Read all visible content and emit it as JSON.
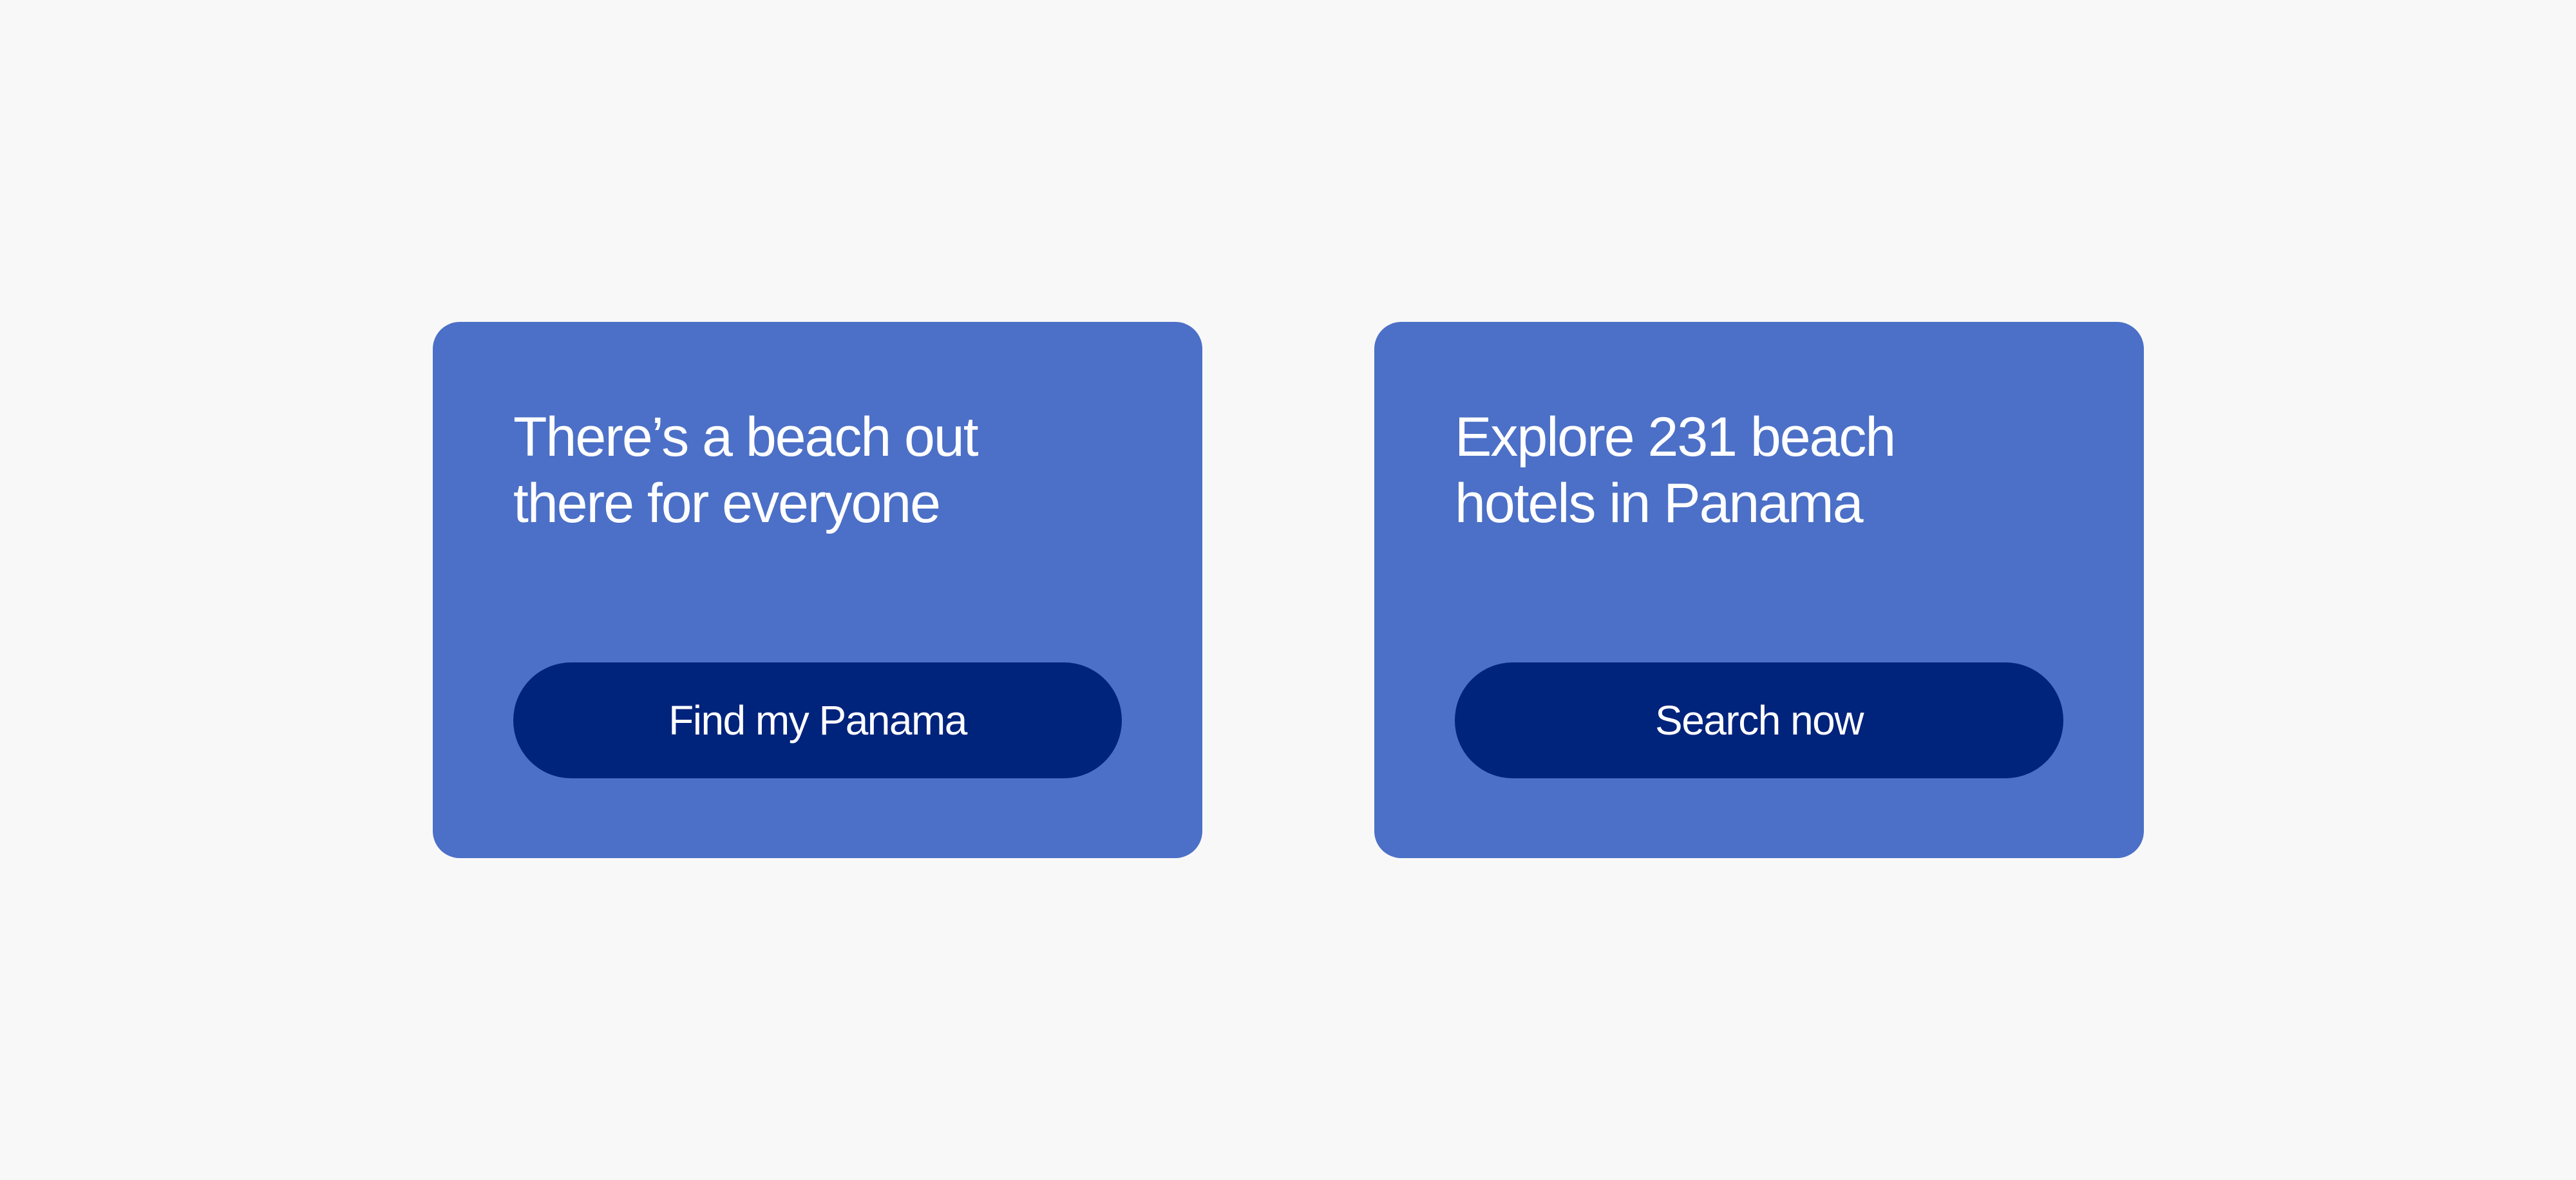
{
  "colors": {
    "page_background": "#f8f8f8",
    "card_background": "#4c70c7",
    "button_background": "#00237c",
    "text": "#ffffff"
  },
  "cards": [
    {
      "heading_line1": "There’s a beach out",
      "heading_line2": "there for everyone",
      "button_label": "Find my Panama"
    },
    {
      "heading_line1": "Explore 231 beach",
      "heading_line2": "hotels in Panama",
      "button_label": "Search now"
    }
  ]
}
